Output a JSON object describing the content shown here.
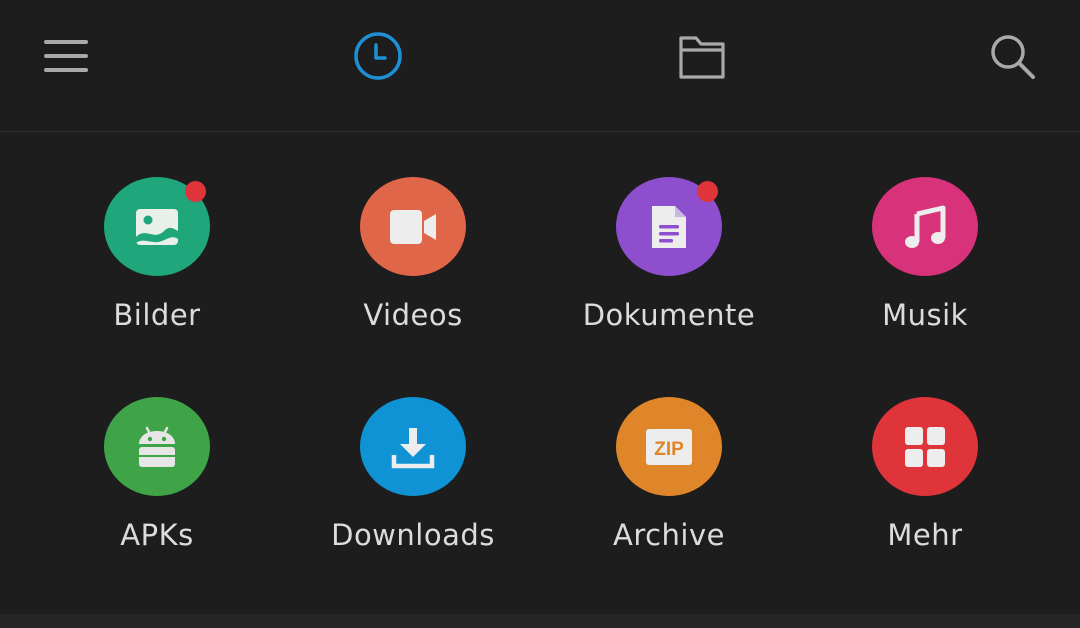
{
  "toolbar": {
    "menu_icon": "hamburger-menu-icon",
    "recent_icon": "clock-icon",
    "folder_icon": "folder-icon",
    "search_icon": "search-icon",
    "active_color": "#1e90d6",
    "icon_color": "#a9a9a9"
  },
  "categories": [
    {
      "label": "Bilder",
      "icon": "image-icon",
      "color": "#1fa67a",
      "badge": true
    },
    {
      "label": "Videos",
      "icon": "video-camera-icon",
      "color": "#e0664a",
      "badge": false
    },
    {
      "label": "Dokumente",
      "icon": "document-icon",
      "color": "#8e4fcf",
      "badge": true
    },
    {
      "label": "Musik",
      "icon": "music-note-icon",
      "color": "#d8327a",
      "badge": false
    },
    {
      "label": "APKs",
      "icon": "android-icon",
      "color": "#3fa447",
      "badge": false
    },
    {
      "label": "Downloads",
      "icon": "download-icon",
      "color": "#0f93d4",
      "badge": false
    },
    {
      "label": "Archive",
      "icon": "zip-archive-icon",
      "color": "#e0862a",
      "badge": false,
      "glyph": "ZIP"
    },
    {
      "label": "Mehr",
      "icon": "grid-more-icon",
      "color": "#e0343b",
      "badge": false
    }
  ]
}
